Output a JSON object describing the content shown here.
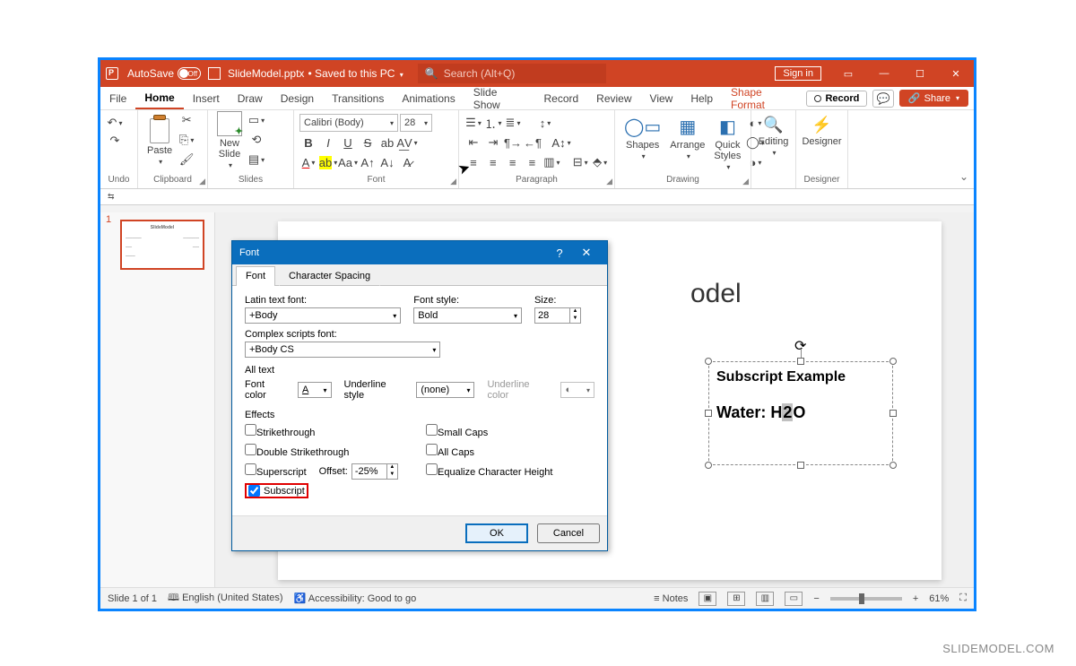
{
  "titlebar": {
    "autosave_label": "AutoSave",
    "autosave_state": "Off",
    "filename": "SlideModel.pptx",
    "save_status": "Saved to this PC",
    "search_placeholder": "Search (Alt+Q)",
    "signin": "Sign in"
  },
  "tabs": {
    "file": "File",
    "home": "Home",
    "insert": "Insert",
    "draw": "Draw",
    "design": "Design",
    "transitions": "Transitions",
    "animations": "Animations",
    "slideshow": "Slide Show",
    "record": "Record",
    "review": "Review",
    "view": "View",
    "help": "Help",
    "shapeformat": "Shape Format",
    "record_btn": "Record",
    "share": "Share"
  },
  "ribbon": {
    "undo_group": "Undo",
    "clipboard_group": "Clipboard",
    "paste": "Paste",
    "slides_group": "Slides",
    "new_slide": "New\nSlide",
    "font_group": "Font",
    "font_name": "Calibri (Body)",
    "font_size": "28",
    "bold": "B",
    "italic": "I",
    "underline": "U",
    "strike": "S",
    "shadow": "S",
    "paragraph_group": "Paragraph",
    "drawing_group": "Drawing",
    "shapes": "Shapes",
    "arrange": "Arrange",
    "quick_styles": "Quick\nStyles",
    "editing_group": "Editing",
    "editing": "Editing",
    "designer_group": "Designer",
    "designer": "Designer"
  },
  "slide": {
    "number": "1",
    "thumb_title": "SlideModel",
    "title_fragment": "odel",
    "textbox_line1": "Subscript Example",
    "textbox_line2_a": "Water: H",
    "textbox_line2_sel": "2",
    "textbox_line2_b": "O"
  },
  "dialog": {
    "title": "Font",
    "tab_font": "Font",
    "tab_charspacing": "Character Spacing",
    "latin_label": "Latin text font:",
    "latin_value": "+Body",
    "fontstyle_label": "Font style:",
    "fontstyle_value": "Bold",
    "size_label": "Size:",
    "size_value": "28",
    "complex_label": "Complex scripts font:",
    "complex_value": "+Body CS",
    "alltext_label": "All text",
    "fontcolor_label": "Font color",
    "underlinestyle_label": "Underline style",
    "underlinestyle_value": "(none)",
    "underlinecolor_label": "Underline color",
    "effects_label": "Effects",
    "strikethrough": "Strikethrough",
    "double_strike": "Double Strikethrough",
    "superscript": "Superscript",
    "offset_label": "Offset:",
    "offset_value": "-25%",
    "subscript": "Subscript",
    "smallcaps": "Small Caps",
    "allcaps": "All Caps",
    "equalize": "Equalize Character Height",
    "ok": "OK",
    "cancel": "Cancel"
  },
  "statusbar": {
    "slide_info": "Slide 1 of 1",
    "language": "English (United States)",
    "accessibility": "Accessibility: Good to go",
    "notes": "Notes",
    "zoom": "61%"
  },
  "watermark": "SLIDEMODEL.COM"
}
